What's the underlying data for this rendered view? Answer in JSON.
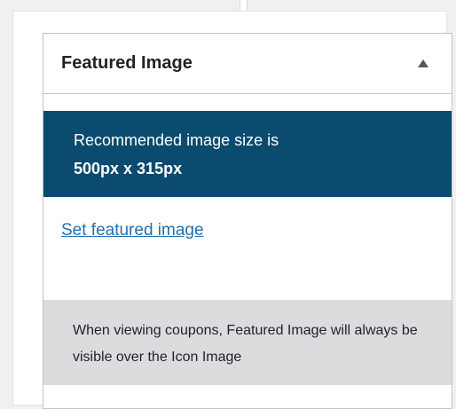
{
  "featured_image_box": {
    "title": "Featured Image",
    "toggle_icon": "triangle-up-icon",
    "notice": {
      "line1": "Recommended image size is",
      "line2": "500px x 315px"
    },
    "set_link_label": "Set featured image",
    "info_text": "When viewing coupons, Featured Image will always be visible over the Icon Image"
  },
  "colors": {
    "notice_background": "#0a4b6f",
    "link": "#2271b1",
    "info_background": "#dcdcde",
    "page_background": "#f0f0f1"
  }
}
